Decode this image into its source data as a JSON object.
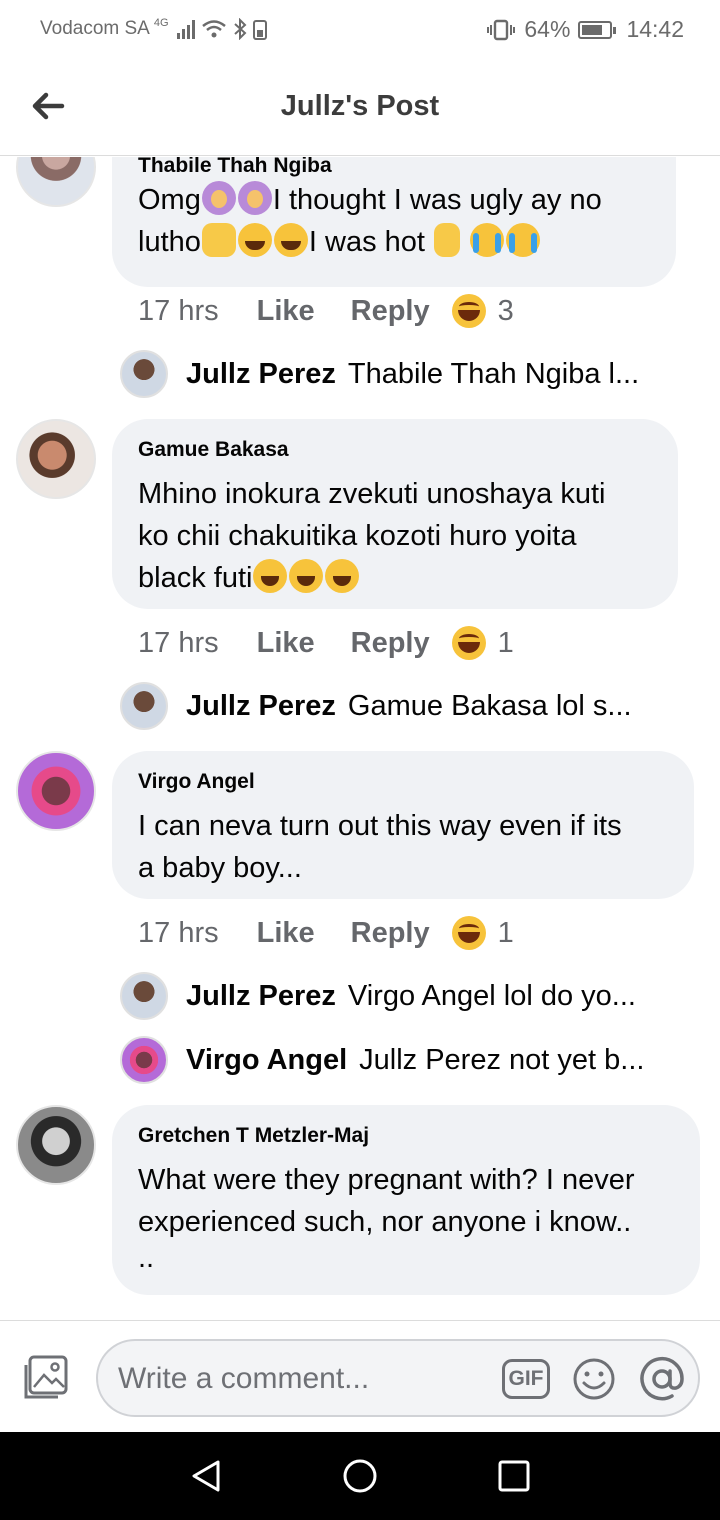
{
  "status_bar": {
    "carrier": "Vodacom SA",
    "network": "4G",
    "battery_percent": "64%",
    "time": "14:42"
  },
  "header": {
    "title": "Jullz's Post"
  },
  "comments": [
    {
      "author": "Thabile Thah Ngiba",
      "text_parts": [
        "Omg",
        "I thought I was ugly ay no lutho",
        "I was hot"
      ],
      "time": "17 hrs",
      "like_label": "Like",
      "reply_label": "Reply",
      "reaction_count": "3",
      "replies": [
        {
          "name": "Jullz Perez",
          "text": "Thabile Thah Ngiba l..."
        }
      ]
    },
    {
      "author": "Gamue Bakasa",
      "text_line1": "Mhino inokura zvekuti unoshaya kuti",
      "text_line2": "ko chii chakuitika kozoti huro yoita",
      "text_line3": "black futi",
      "time": "17 hrs",
      "like_label": "Like",
      "reply_label": "Reply",
      "reaction_count": "1",
      "replies": [
        {
          "name": "Jullz Perez",
          "text": "Gamue Bakasa lol s..."
        }
      ]
    },
    {
      "author": "Virgo Angel",
      "text_line1": "I can neva turn out this way even if its",
      "text_line2": "a baby boy...",
      "time": "17 hrs",
      "like_label": "Like",
      "reply_label": "Reply",
      "reaction_count": "1",
      "replies": [
        {
          "name": "Jullz Perez",
          "text": "Virgo Angel lol do yo..."
        },
        {
          "name": "Virgo Angel",
          "text": "Jullz Perez not yet b..."
        }
      ]
    },
    {
      "author": "Gretchen T Metzler-Maj",
      "text_line1": "What were they pregnant with? I never",
      "text_line2": "experienced such, nor anyone i know..",
      "text_line3": ".."
    }
  ],
  "composer": {
    "placeholder": "Write a comment...",
    "gif_label": "GIF"
  },
  "colors": {
    "bubble": "#f0f2f5",
    "meta_text": "#65676b",
    "navbar": "#000000"
  }
}
